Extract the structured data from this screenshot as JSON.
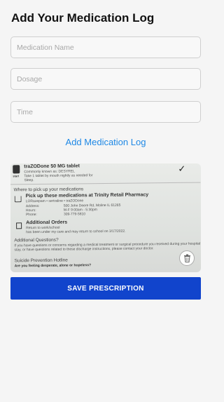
{
  "title": "Add Your Medication Log",
  "fields": {
    "medication_name": {
      "placeholder": "Medication Name",
      "value": ""
    },
    "dosage": {
      "placeholder": "Dosage",
      "value": ""
    },
    "time": {
      "placeholder": "Time",
      "value": ""
    }
  },
  "add_link_label": "Add Medication Log",
  "photo": {
    "start_label": "start",
    "drug_line": "traZODone 50 MG tablet",
    "known_as": "Commonly known as: DESYREL",
    "instruction_1": "Take 1 tablet by mouth nightly as needed for",
    "instruction_2": "Sleep.",
    "pickup_heading": "Where to pick up your medications",
    "pickup_title": "Pick up these medications at Trinity Retail Pharmacy",
    "pickup_meds": "LORazepam • sertraline • traZODone",
    "address_label": "Address:",
    "address_value": "500 John Deere Rd, Moline IL 61265",
    "hours_label": "Hours:",
    "hours_value": "M-F 9:00am - 5:30pm",
    "phone_label": "Phone:",
    "phone_value": "309-779-5810",
    "orders_title": "Additional Orders",
    "orders_1": "Return to work/school",
    "orders_2": "has been under my care and may return to school on 3/17/2022.",
    "questions_title": "Additional Questions?",
    "questions_1": "If you have questions or concerns regarding a medical treatment or surgical procedure you received during your hospital",
    "questions_2": "stay, or have questions related to these discharge instructions, please contact your doctor.",
    "hotline_title": "Suicide Prevention Hotline",
    "hotline_sub": "Are you feeling desperate, alone or hopeless?"
  },
  "save_button_label": "SAVE PRESCRIPTION",
  "colors": {
    "accent_link": "#1e88e5",
    "primary_button": "#1144cc",
    "background": "#f5f5f5"
  }
}
